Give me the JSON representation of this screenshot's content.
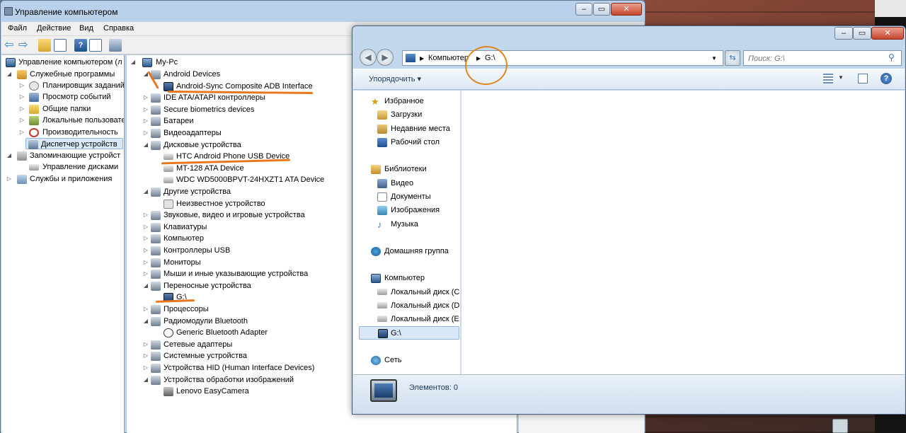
{
  "cm_window": {
    "title": "Управление компьютером",
    "menu": [
      "Файл",
      "Действие",
      "Вид",
      "Справка"
    ],
    "left_tree": [
      {
        "label": "Управление компьютером (л",
        "arrow": "",
        "level": 0
      },
      {
        "label": "Служебные программы",
        "arrow": "◢",
        "level": 1
      },
      {
        "label": "Планировщик заданий",
        "arrow": "▷",
        "level": 2
      },
      {
        "label": "Просмотр событий",
        "arrow": "▷",
        "level": 2
      },
      {
        "label": "Общие папки",
        "arrow": "▷",
        "level": 2
      },
      {
        "label": "Локальные пользовате",
        "arrow": "▷",
        "level": 2
      },
      {
        "label": "Производительность",
        "arrow": "▷",
        "level": 2
      },
      {
        "label": "Диспетчер устройств",
        "arrow": "",
        "level": 2
      },
      {
        "label": "Запоминающие устройст",
        "arrow": "◢",
        "level": 1
      },
      {
        "label": "Управление дисками",
        "arrow": "",
        "level": 2
      },
      {
        "label": "Службы и приложения",
        "arrow": "▷",
        "level": 1
      }
    ],
    "device_tree": {
      "root": "My-Pc",
      "rows": [
        {
          "label": "Android Devices",
          "arrow": "◢",
          "level": 1
        },
        {
          "label": "Android-Sync Composite ADB Interface",
          "arrow": "",
          "level": 2
        },
        {
          "label": "IDE ATA/ATAPI контроллеры",
          "arrow": "▷",
          "level": 1
        },
        {
          "label": "Secure biometrics devices",
          "arrow": "▷",
          "level": 1
        },
        {
          "label": "Батареи",
          "arrow": "▷",
          "level": 1
        },
        {
          "label": "Видеоадаптеры",
          "arrow": "▷",
          "level": 1
        },
        {
          "label": "Дисковые устройства",
          "arrow": "◢",
          "level": 1
        },
        {
          "label": "HTC Android Phone USB Device",
          "arrow": "",
          "level": 2
        },
        {
          "label": "MT-128 ATA Device",
          "arrow": "",
          "level": 2
        },
        {
          "label": "WDC WD5000BPVT-24HXZT1 ATA Device",
          "arrow": "",
          "level": 2
        },
        {
          "label": "Другие устройства",
          "arrow": "◢",
          "level": 1
        },
        {
          "label": "Неизвестное устройство",
          "arrow": "",
          "level": 2
        },
        {
          "label": "Звуковые, видео и игровые устройства",
          "arrow": "▷",
          "level": 1
        },
        {
          "label": "Клавиатуры",
          "arrow": "▷",
          "level": 1
        },
        {
          "label": "Компьютер",
          "arrow": "▷",
          "level": 1
        },
        {
          "label": "Контроллеры USB",
          "arrow": "▷",
          "level": 1
        },
        {
          "label": "Мониторы",
          "arrow": "▷",
          "level": 1
        },
        {
          "label": "Мыши и иные указывающие устройства",
          "arrow": "▷",
          "level": 1
        },
        {
          "label": "Переносные устройства",
          "arrow": "◢",
          "level": 1
        },
        {
          "label": "G:\\",
          "arrow": "",
          "level": 2
        },
        {
          "label": "Процессоры",
          "arrow": "▷",
          "level": 1
        },
        {
          "label": "Радиомодули Bluetooth",
          "arrow": "◢",
          "level": 1
        },
        {
          "label": "Generic Bluetooth Adapter",
          "arrow": "",
          "level": 2
        },
        {
          "label": "Сетевые адаптеры",
          "arrow": "▷",
          "level": 1
        },
        {
          "label": "Системные устройства",
          "arrow": "▷",
          "level": 1
        },
        {
          "label": "Устройства HID (Human Interface Devices)",
          "arrow": "▷",
          "level": 1
        },
        {
          "label": "Устройства обработки изображений",
          "arrow": "◢",
          "level": 1
        },
        {
          "label": "Lenovo EasyCamera",
          "arrow": "",
          "level": 2
        }
      ]
    }
  },
  "explorer": {
    "breadcrumb": [
      "Компьютер",
      "G:\\"
    ],
    "search_placeholder": "Поиск: G:\\",
    "organize_label": "Упорядочить ▾",
    "nav": {
      "favorites": {
        "title": "Избранное",
        "items": [
          "Загрузки",
          "Недавние места",
          "Рабочий стол"
        ]
      },
      "libraries": {
        "title": "Библиотеки",
        "items": [
          "Видео",
          "Документы",
          "Изображения",
          "Музыка"
        ]
      },
      "homegroup": "Домашняя группа",
      "computer": {
        "title": "Компьютер",
        "items": [
          "Локальный диск (C",
          "Локальный диск (D",
          "Локальный диск (E:",
          "G:\\"
        ]
      },
      "network": "Сеть"
    },
    "status": "Элементов: 0"
  },
  "colors": {
    "annotation": "#e8781e",
    "selection": "#d9e8f7"
  }
}
